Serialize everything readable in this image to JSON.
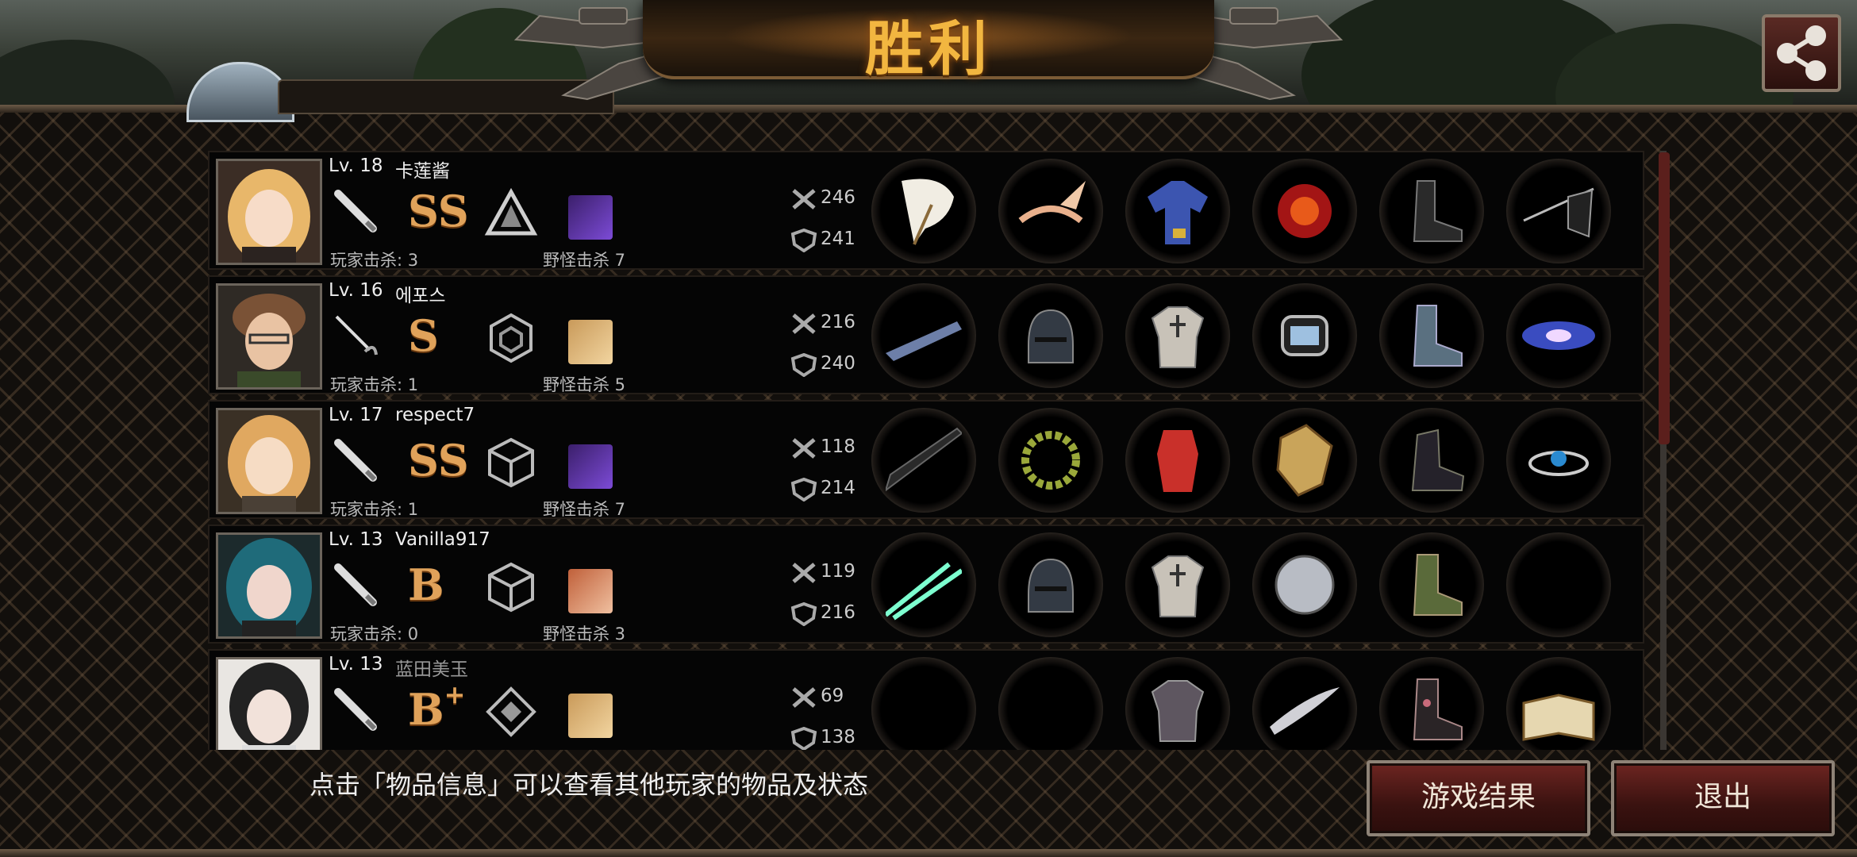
{
  "header": {
    "title": "胜利"
  },
  "players": [
    {
      "level": "Lv. 18",
      "name": "卡莲酱",
      "grade": "SS",
      "grade_sup": "",
      "player_kills": "玩家击杀: 3",
      "monster_kills": "野怪击杀 7",
      "attack": "246",
      "defense": "241",
      "items": [
        "white-fan",
        "pink-wing-headband",
        "blue-robe",
        "red-gem-brooch",
        "black-boots",
        "black-flag"
      ]
    },
    {
      "level": "Lv. 16",
      "name": "에포스",
      "grade": "S",
      "grade_sup": "",
      "player_kills": "玩家击杀: 1",
      "monster_kills": "野怪击杀 5",
      "attack": "216",
      "defense": "240",
      "items": [
        "serrated-blade",
        "knight-helmet",
        "plate-armor",
        "wrist-watch",
        "steel-boots",
        "galaxy"
      ]
    },
    {
      "level": "Lv. 17",
      "name": "respect7",
      "grade": "SS",
      "grade_sup": "",
      "player_kills": "玩家击杀: 1",
      "monster_kills": "野怪击杀 7",
      "attack": "118",
      "defense": "214",
      "items": [
        "black-umbrella",
        "laurel-wreath",
        "red-dress",
        "golden-shield",
        "black-heels",
        "sapphire-bracelet"
      ]
    },
    {
      "level": "Lv. 13",
      "name": "Vanilla917",
      "grade": "B",
      "grade_sup": "",
      "player_kills": "玩家击杀: 0",
      "monster_kills": "野怪击杀 3",
      "attack": "119",
      "defense": "216",
      "items": [
        "twin-lightsabers",
        "knight-helmet",
        "plate-armor",
        "round-shield",
        "camo-boots",
        "empty"
      ]
    },
    {
      "level": "Lv. 13",
      "name": "蓝田美玉",
      "grade": "B",
      "grade_sup": "+",
      "player_kills": "",
      "monster_kills": "",
      "attack": "69",
      "defense": "138",
      "items": [
        "empty",
        "empty",
        "stone-armor",
        "silver-blade",
        "flower-boots",
        "ancient-book"
      ]
    }
  ],
  "footer": {
    "hint": "点击「物品信息」可以查看其他玩家的物品及状态",
    "results_button": "游戏结果",
    "exit_button": "退出"
  },
  "colors": {
    "accent": "#f2b640",
    "button": "#6d2521",
    "grade": "#e0a25a"
  }
}
